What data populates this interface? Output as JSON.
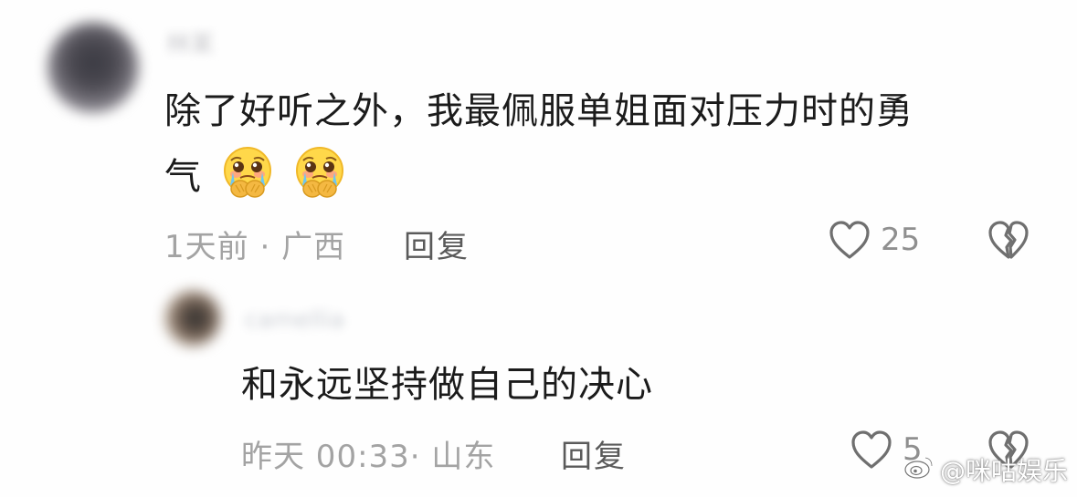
{
  "comment": {
    "author_name": "林某",
    "text_line1": "除了好听之外，我最佩服单姐面对压力时的勇",
    "text_line2": "气",
    "emojis": [
      "pleading-face-hands-emoji",
      "pleading-face-hands-emoji"
    ],
    "time": "1天前",
    "separator": "·",
    "location": "广西",
    "reply_label": "回复",
    "like_count": "25"
  },
  "reply": {
    "author_name": "camellia",
    "text": "和永远坚持做自己的决心",
    "time": "昨天 00:33",
    "separator": "·",
    "location": "山东",
    "reply_label": "回复",
    "like_count": "5"
  },
  "watermark": {
    "text": "@咪咕娱乐"
  },
  "colors": {
    "text": "#1b1b1b",
    "meta": "#a3a3a3",
    "icon": "#6f6f6f"
  }
}
